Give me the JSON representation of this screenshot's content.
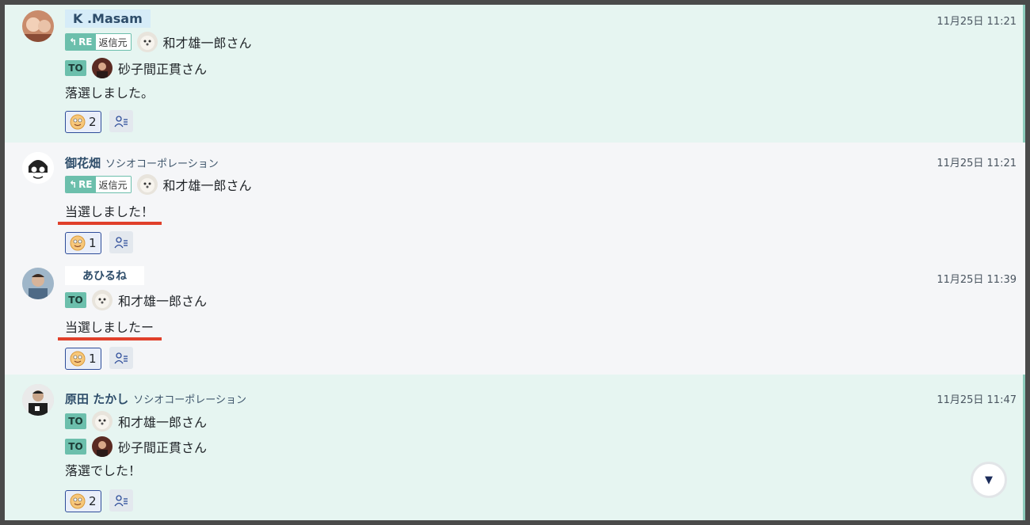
{
  "messages": [
    {
      "sender": "K .Masam",
      "org": "",
      "time": "11月25日 11:21",
      "reply_label": "RE",
      "reply_source": "返信元",
      "reply_to": "和才雄一郎さん",
      "to": [
        "砂子間正貫さん"
      ],
      "body": "落選しました。",
      "reaction_count": "2"
    },
    {
      "sender": "御花畑",
      "org": "ソシオコーポレーション",
      "time": "11月25日 11:21",
      "reply_label": "RE",
      "reply_source": "返信元",
      "reply_to": "和才雄一郎さん",
      "body": "当選しました！",
      "reaction_count": "1"
    },
    {
      "sender": "あひるね",
      "org": "",
      "time": "11月25日 11:39",
      "to": [
        "和才雄一郎さん"
      ],
      "body": "当選しましたー",
      "reaction_count": "1"
    },
    {
      "sender": "原田 たかし",
      "org": "ソシオコーポレーション",
      "time": "11月25日 11:47",
      "to": [
        "和才雄一郎さん",
        "砂子間正貫さん"
      ],
      "body": "落選でした！",
      "reaction_count": "2"
    }
  ],
  "to_label": "TO",
  "icons": {
    "reply": "reply-arrow-icon",
    "reaction": "smile-face-icon",
    "readers": "readers-list-icon",
    "scroll": "scroll-down-icon"
  },
  "colors": {
    "highlight_bg": "#e6f5f1",
    "badge": "#6cbfac",
    "name": "#2e4d6a",
    "underline": "#e0402b"
  },
  "scroll_glyph": "▼"
}
